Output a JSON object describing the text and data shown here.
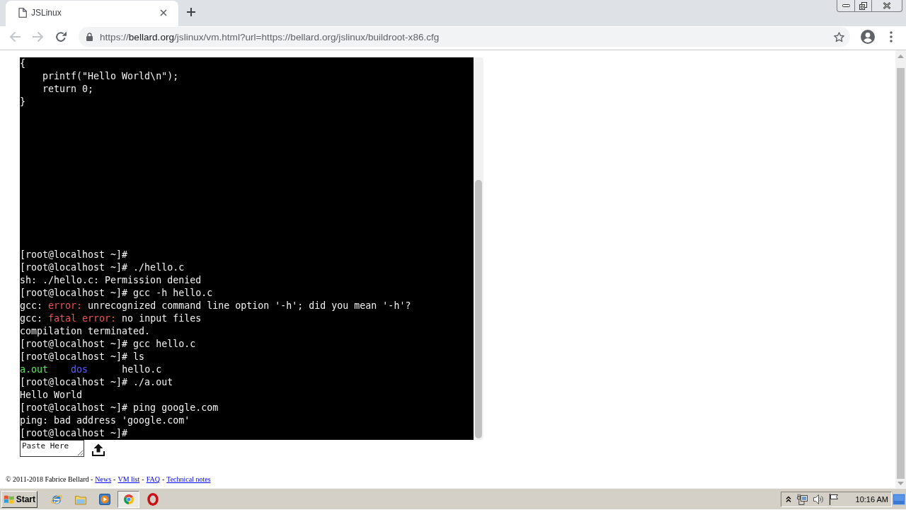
{
  "browser": {
    "tab": {
      "title": "JSLinux"
    },
    "toolbar": {
      "back": {
        "disabled": true
      },
      "forward": {
        "disabled": true
      }
    },
    "address": {
      "scheme": "https://",
      "host": "bellard.org",
      "path": "/jslinux/vm.html?url=https://bellard.org/jslinux/buildroot-x86.cfg"
    }
  },
  "terminal": {
    "upper_lines": [
      [
        {
          "text": "{"
        }
      ],
      [
        {
          "text": "    printf(\"Hello World\\n\");"
        }
      ],
      [
        {
          "text": "    return 0;"
        }
      ],
      [
        {
          "text": "}"
        }
      ]
    ],
    "lower_lines": [
      [
        {
          "text": "[root@localhost ~]#"
        }
      ],
      [
        {
          "text": "[root@localhost ~]# ./hello.c"
        }
      ],
      [
        {
          "text": "sh: ./hello.c: Permission denied"
        }
      ],
      [
        {
          "text": "[root@localhost ~]# gcc -h hello.c"
        }
      ],
      [
        {
          "text": "gcc: "
        },
        {
          "text": "error:",
          "color": "#ee5555"
        },
        {
          "text": " unrecognized command line option '-h'; did you mean '-h'?"
        }
      ],
      [
        {
          "text": "gcc: "
        },
        {
          "text": "fatal error:",
          "color": "#ee5555"
        },
        {
          "text": " no input files"
        }
      ],
      [
        {
          "text": "compilation terminated."
        }
      ],
      [
        {
          "text": "[root@localhost ~]# gcc hello.c"
        }
      ],
      [
        {
          "text": "[root@localhost ~]# ls"
        }
      ],
      [
        {
          "text": "a.out    ",
          "color": "#55ee55"
        },
        {
          "text": "dos      ",
          "color": "#5c5cff"
        },
        {
          "text": "hello.c"
        }
      ],
      [
        {
          "text": "[root@localhost ~]# ./a.out"
        }
      ],
      [
        {
          "text": "Hello World"
        }
      ],
      [
        {
          "text": "[root@localhost ~]# ping google.com"
        }
      ],
      [
        {
          "text": "ping: bad address 'google.com'"
        }
      ],
      [
        {
          "text": "[root@localhost ~]#"
        }
      ]
    ]
  },
  "paste_field": {
    "placeholder": "Paste Here"
  },
  "footer": {
    "parts": [
      {
        "kind": "text",
        "text": "© 2011-2018 Fabrice Bellard -"
      },
      {
        "kind": "link",
        "text": "News"
      },
      {
        "kind": "text",
        "text": "-"
      },
      {
        "kind": "link",
        "text": "VM list"
      },
      {
        "kind": "text",
        "text": "-"
      },
      {
        "kind": "link",
        "text": "FAQ"
      },
      {
        "kind": "text",
        "text": "-"
      },
      {
        "kind": "link",
        "text": "Technical notes"
      }
    ]
  },
  "taskbar": {
    "start": {
      "label": "Start"
    },
    "apps": [
      {
        "kind": "globe",
        "selected": false
      },
      {
        "kind": "folder",
        "selected": false
      },
      {
        "kind": "player",
        "selected": false
      },
      {
        "kind": "ball",
        "selected": true
      },
      {
        "kind": "ring",
        "selected": false
      }
    ],
    "clock": "10:16 AM"
  }
}
